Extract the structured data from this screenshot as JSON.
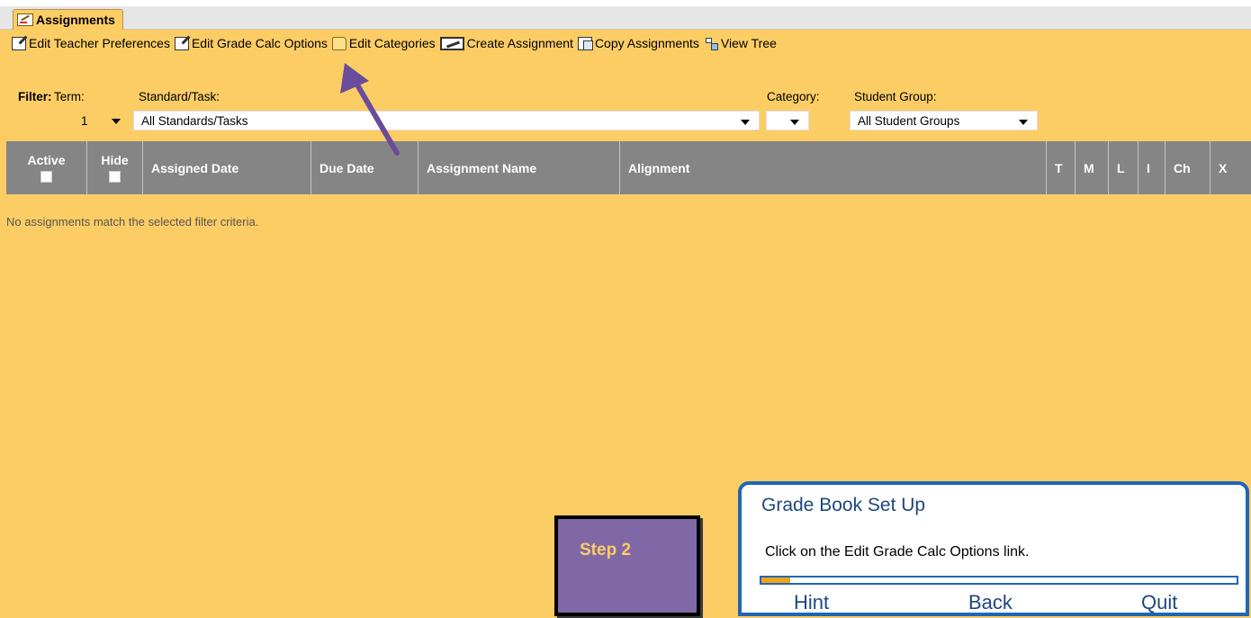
{
  "tab": {
    "label": "Assignments"
  },
  "toolbar": {
    "edit_teacher_prefs": "Edit Teacher Preferences",
    "edit_grade_calc": "Edit Grade Calc Options",
    "edit_categories": "Edit Categories",
    "create_assignment": "Create Assignment",
    "copy_assignments": "Copy Assignments",
    "view_tree": "View Tree"
  },
  "filter": {
    "filter_label": "Filter:",
    "term_label": "Term:",
    "standard_label": "Standard/Task:",
    "category_label": "Category:",
    "group_label": "Student Group:",
    "term_value": "1",
    "standard_value": "All Standards/Tasks",
    "category_value": "",
    "group_value": "All Student Groups"
  },
  "table": {
    "columns": {
      "active": "Active",
      "hide": "Hide",
      "assigned_date": "Assigned Date",
      "due_date": "Due Date",
      "assignment_name": "Assignment Name",
      "alignment": "Alignment",
      "t": "T",
      "m": "M",
      "l": "L",
      "i": "I",
      "ch": "Ch",
      "x": "X"
    },
    "empty_message": "No assignments match the selected filter criteria."
  },
  "step_box": {
    "label": "Step 2"
  },
  "guide": {
    "title": "Grade Book Set Up",
    "message": "Click on the Edit Grade Calc Options link.",
    "progress": 0.06,
    "hint": "Hint",
    "back": "Back",
    "quit": "Quit"
  },
  "colors": {
    "background": "#FDCD65",
    "header": "#858585",
    "panel_border": "#1F66B8",
    "step_fill": "#8067A6",
    "arrow": "#6A4C9C"
  }
}
